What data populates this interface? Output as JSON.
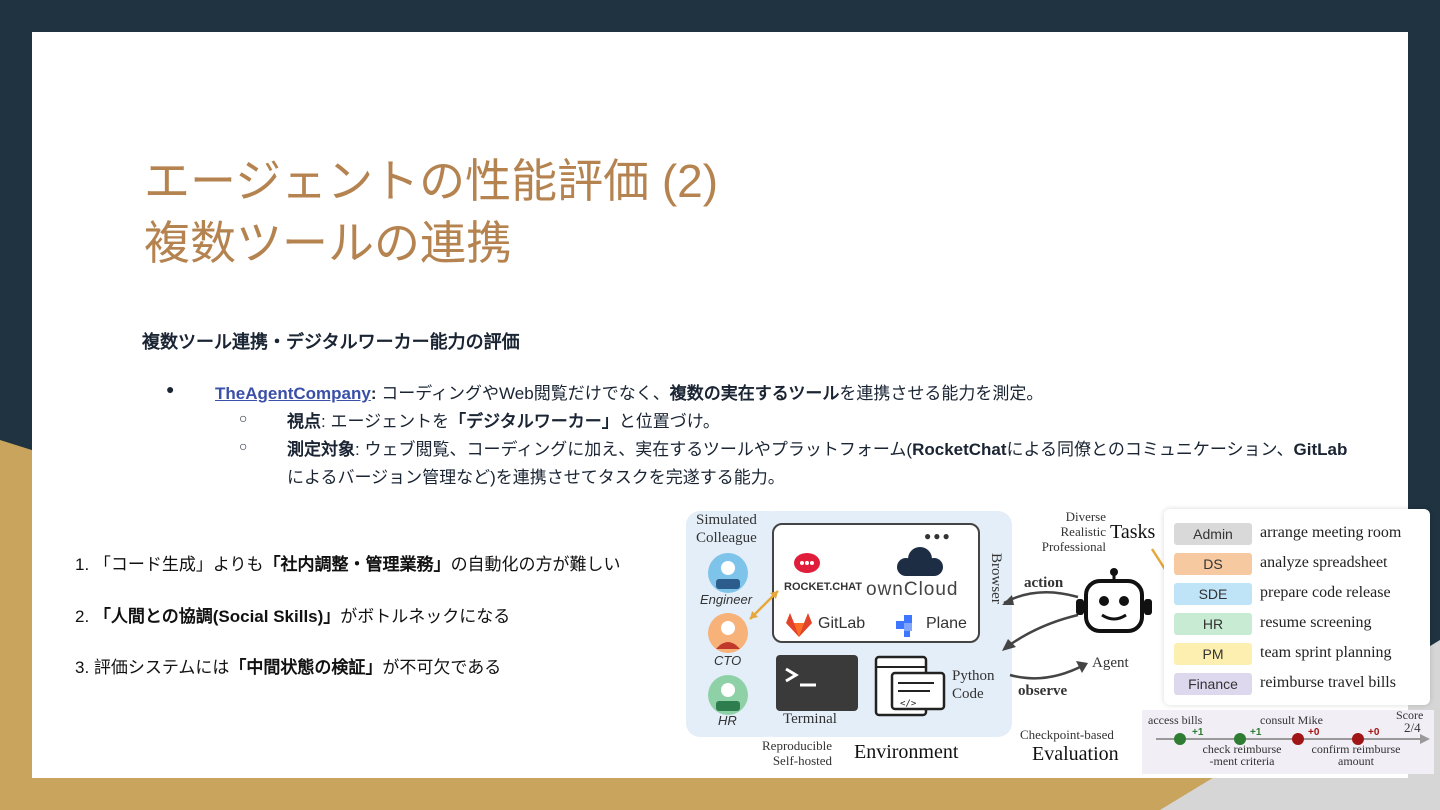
{
  "slide": {
    "title_line1": "エージェントの性能評価 (2)",
    "title_line2": "複数ツールの連携",
    "subheading": "複数ツール連携・デジタルワーカー能力の評価",
    "bullet1": {
      "link": "TheAgentCompany",
      "colon": ":",
      "text_a": " コーディングやWeb閲覧だけでなく、",
      "bold": "複数の実在するツール",
      "text_b": "を連携させる能力を測定。"
    },
    "bullet2": {
      "bold": "視点",
      "text_a": ": エージェントを",
      "bold2": "「デジタルワーカー」",
      "text_b": "と位置づけ。"
    },
    "bullet3": {
      "bold": "測定対象",
      "text_a": ": ウェブ閲覧、コーディングに加え、実在するツールやプラットフォーム(",
      "rc": "RocketChat",
      "text_b": "による同僚とのコミュニケーション、",
      "gl": "GitLab",
      "line2": "によるバージョン管理など)を連携させてタスクを完遂する能力。"
    },
    "numbered": [
      {
        "pre": "1. 「コード生成」よりも",
        "bold": "「社内調整・管理業務」",
        "post": "の自動化の方が難しい"
      },
      {
        "pre": "2. ",
        "bold": "「人間との協調(Social Skills)」",
        "post": "がボトルネックになる"
      },
      {
        "pre": "3. 評価システムには",
        "bold": "「中間状態の検証」",
        "post": "が不可欠である"
      }
    ]
  },
  "figure": {
    "simulated": "Simulated",
    "colleague": "Colleague",
    "roles": [
      "Engineer",
      "CTO",
      "HR"
    ],
    "browser_label": "Browser",
    "apps": {
      "rocketchat": "ROCKET.CHAT",
      "owncloud": "ownCloud",
      "gitlab": "GitLab",
      "plane": "Plane"
    },
    "terminal": "Terminal",
    "python_line1": "Python",
    "python_line2": "Code",
    "env_note1": "Reproducible",
    "env_note2": "Self-hosted",
    "environment": "Environment",
    "action": "action",
    "observe": "observe",
    "agent": "Agent",
    "tasks_note1": "Diverse",
    "tasks_note2": "Realistic",
    "tasks_note3": "Professional",
    "tasks": "Tasks",
    "task_list": [
      {
        "tag": "Admin",
        "desc": "arrange meeting room",
        "color": "#d9d9d9"
      },
      {
        "tag": "DS",
        "desc": "analyze spreadsheet",
        "color": "#f6c9a0"
      },
      {
        "tag": "SDE",
        "desc": "prepare code release",
        "color": "#bfe3f7"
      },
      {
        "tag": "HR",
        "desc": "resume screening",
        "color": "#c8ebd3"
      },
      {
        "tag": "PM",
        "desc": "team sprint planning",
        "color": "#fdefb0"
      },
      {
        "tag": "Finance",
        "desc": "reimburse travel bills",
        "color": "#ddd8ee"
      }
    ],
    "eval1": "Checkpoint-based",
    "eval2": "Evaluation",
    "checkpoints": {
      "access": "access bills",
      "consult": "consult Mike",
      "check1": "check reimburse",
      "check2": "-ment criteria",
      "confirm1": "confirm reimburse",
      "confirm2": "amount",
      "p1": "+1",
      "p2": "+1",
      "p3": "+0",
      "p4": "+0",
      "score_label": "Score",
      "score": "2/4"
    }
  }
}
